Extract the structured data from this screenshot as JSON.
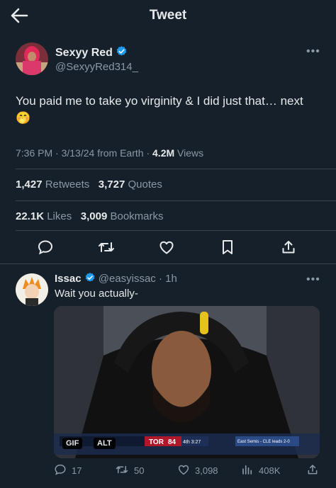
{
  "header": {
    "title": "Tweet"
  },
  "tweet": {
    "author": {
      "name": "Sexyy Red",
      "handle": "@SexyyRed314_"
    },
    "text": "You paid me to take yo virginity & I did just that… next",
    "emoji": "🤭",
    "time": "7:36 PM",
    "date": "3/13/24",
    "source": "from Earth",
    "views_count": "4.2M",
    "views_label": "Views",
    "retweets_count": "1,427",
    "retweets_label": "Retweets",
    "quotes_count": "3,727",
    "quotes_label": "Quotes",
    "likes_count": "22.1K",
    "likes_label": "Likes",
    "bookmarks_count": "3,009",
    "bookmarks_label": "Bookmarks"
  },
  "reply": {
    "author": {
      "name": "Issac",
      "handle": "@easyissac"
    },
    "age": "1h",
    "text": "Wait you actually-",
    "media": {
      "gif_badge": "GIF",
      "alt_badge": "ALT",
      "scoreboard_team": "TOR",
      "scoreboard_score": "84",
      "scoreboard_quarter": "4th 3:27",
      "scoreboard_series": "East Semis - CLE leads 2-0"
    },
    "stats": {
      "replies": "17",
      "retweets": "50",
      "likes": "3,098",
      "views": "408K"
    }
  },
  "colors": {
    "background": "#15202b",
    "text": "#e7e9ea",
    "muted": "#8b98a5",
    "verified": "#1d9bf0",
    "divider": "#38444d"
  }
}
